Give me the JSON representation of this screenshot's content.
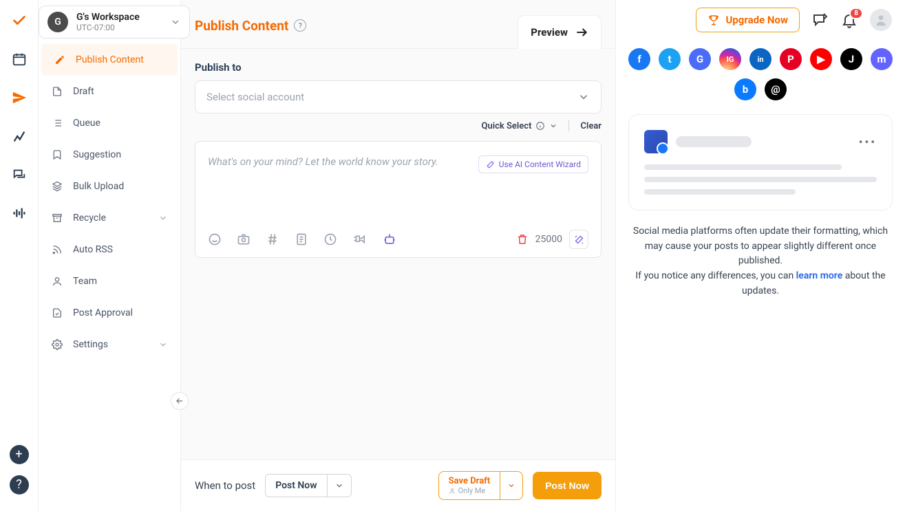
{
  "workspace": {
    "initial": "G",
    "name": "G's Workspace",
    "timezone": "UTC-07:00"
  },
  "top": {
    "upgrade": "Upgrade Now",
    "notifications_count": "8"
  },
  "sidebar": {
    "items": [
      {
        "label": "Publish Content"
      },
      {
        "label": "Draft"
      },
      {
        "label": "Queue"
      },
      {
        "label": "Suggestion"
      },
      {
        "label": "Bulk Upload"
      },
      {
        "label": "Recycle"
      },
      {
        "label": "Auto RSS"
      },
      {
        "label": "Team"
      },
      {
        "label": "Post Approval"
      },
      {
        "label": "Settings"
      }
    ]
  },
  "page": {
    "title": "Publish Content",
    "preview": "Preview"
  },
  "compose": {
    "publish_to": "Publish to",
    "select_placeholder": "Select social account",
    "quick_select": "Quick Select",
    "clear": "Clear",
    "editor_placeholder": "What's on your mind? Let the world know your story.",
    "ai_wizard": "Use AI Content Wizard",
    "char_limit": "25000"
  },
  "footer": {
    "when_label": "When to post",
    "when_value": "Post Now",
    "save_draft": "Save Draft",
    "save_sub": "Only Me",
    "post_now": "Post Now"
  },
  "preview_panel": {
    "note1": "Social media platforms often update their formatting, which may cause your posts to appear slightly different once published.",
    "note2a": "If you notice any differences, you can ",
    "learn_more": "learn more",
    "note2b": " about the updates."
  },
  "socials": [
    {
      "name": "facebook",
      "bg": "#1877f2",
      "text": "f"
    },
    {
      "name": "twitter",
      "bg": "#1da1f2",
      "text": "t"
    },
    {
      "name": "google",
      "bg": "#4a6cf7",
      "text": "G"
    },
    {
      "name": "instagram",
      "bg": "#e1306c",
      "text": "IG"
    },
    {
      "name": "linkedin",
      "bg": "#0a66c2",
      "text": "in"
    },
    {
      "name": "pinterest",
      "bg": "#e60023",
      "text": "P"
    },
    {
      "name": "youtube",
      "bg": "#ff0000",
      "text": "▶"
    },
    {
      "name": "tiktok",
      "bg": "#000000",
      "text": "J"
    },
    {
      "name": "mastodon",
      "bg": "#6364ff",
      "text": "m"
    },
    {
      "name": "bluesky",
      "bg": "#0a7aff",
      "text": "b"
    },
    {
      "name": "threads",
      "bg": "#000000",
      "text": "@"
    }
  ]
}
